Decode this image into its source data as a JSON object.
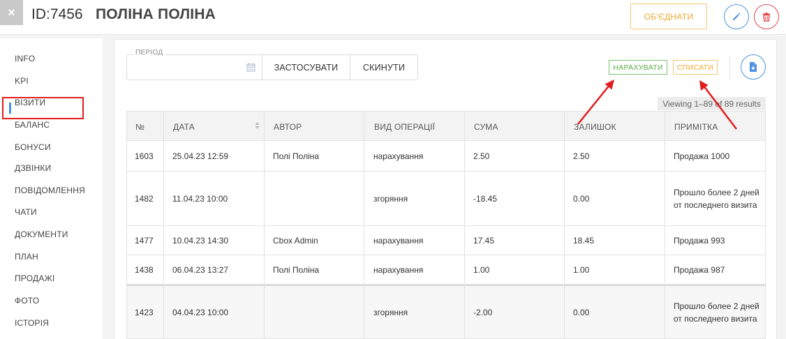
{
  "header": {
    "close_icon": "×",
    "record_id": "ID:7456",
    "record_name": "ПОЛІНА ПОЛІНА",
    "merge_label": "ОБ'ЄДНАТИ",
    "edit_icon": "pencil-icon",
    "delete_icon": "trash-icon"
  },
  "sidebar": {
    "items": [
      {
        "label": "INFO"
      },
      {
        "label": "KPI"
      },
      {
        "label": "ВІЗИТИ"
      },
      {
        "label": "БАЛАНС"
      },
      {
        "label": "БОНУСИ"
      },
      {
        "label": "ДЗВІНКИ"
      },
      {
        "label": "ПОВІДОМЛЕННЯ"
      },
      {
        "label": "ЧАТИ"
      },
      {
        "label": "ДОКУМЕНТИ"
      },
      {
        "label": "ПЛАН"
      },
      {
        "label": "ПРОДАЖІ"
      },
      {
        "label": "ФОТО"
      },
      {
        "label": "ІСТОРІЯ"
      }
    ],
    "active": "БОНУСИ"
  },
  "filters": {
    "period_label": "ПЕРІОД",
    "period_value": "",
    "apply_label": "ЗАСТОСУВАТИ",
    "reset_label": "СКИНУТИ"
  },
  "actions": {
    "accrue_label": "НАРАХУВАТИ",
    "writeoff_label": "СПИСАТИ",
    "export_icon": "download-file-icon"
  },
  "summary": "Viewing 1–89 of 89 results",
  "table": {
    "columns": [
      "№",
      "ДАТА",
      "АВТОР",
      "ВИД ОПЕРАЦІЇ",
      "СУМА",
      "ЗАЛИШОК",
      "ПРИМІТКА"
    ],
    "rows": [
      {
        "id": "1603",
        "date": "25.04.23 12:59",
        "author": "Полі Поліна",
        "type": "нарахування",
        "amount": "2.50",
        "balance": "2.50",
        "note": "Продажа 1000"
      },
      {
        "id": "1482",
        "date": "11.04.23 10:00",
        "author": "",
        "type": "згоряння",
        "amount": "-18.45",
        "balance": "0.00",
        "note": "Прошло более 2 дней от последнего визита"
      },
      {
        "id": "1477",
        "date": "10.04.23 14:30",
        "author": "Cbox Admin",
        "type": "нарахування",
        "amount": "17.45",
        "balance": "18.45",
        "note": "Продажа 993"
      },
      {
        "id": "1438",
        "date": "06.04.23 13:27",
        "author": "Полі Поліна",
        "type": "нарахування",
        "amount": "1.00",
        "balance": "1.00",
        "note": "Продажа 987"
      },
      {
        "id": "1423",
        "date": "04.04.23 10:00",
        "author": "",
        "type": "згоряння",
        "amount": "-2.00",
        "balance": "0.00",
        "note": "Прошло более 2 дней от последнего визита"
      }
    ]
  },
  "colors": {
    "accent": "#4a90e2",
    "danger": "#e0474c",
    "warning": "#f0a830",
    "success": "#5aab48",
    "annotation": "#e21c1c"
  }
}
